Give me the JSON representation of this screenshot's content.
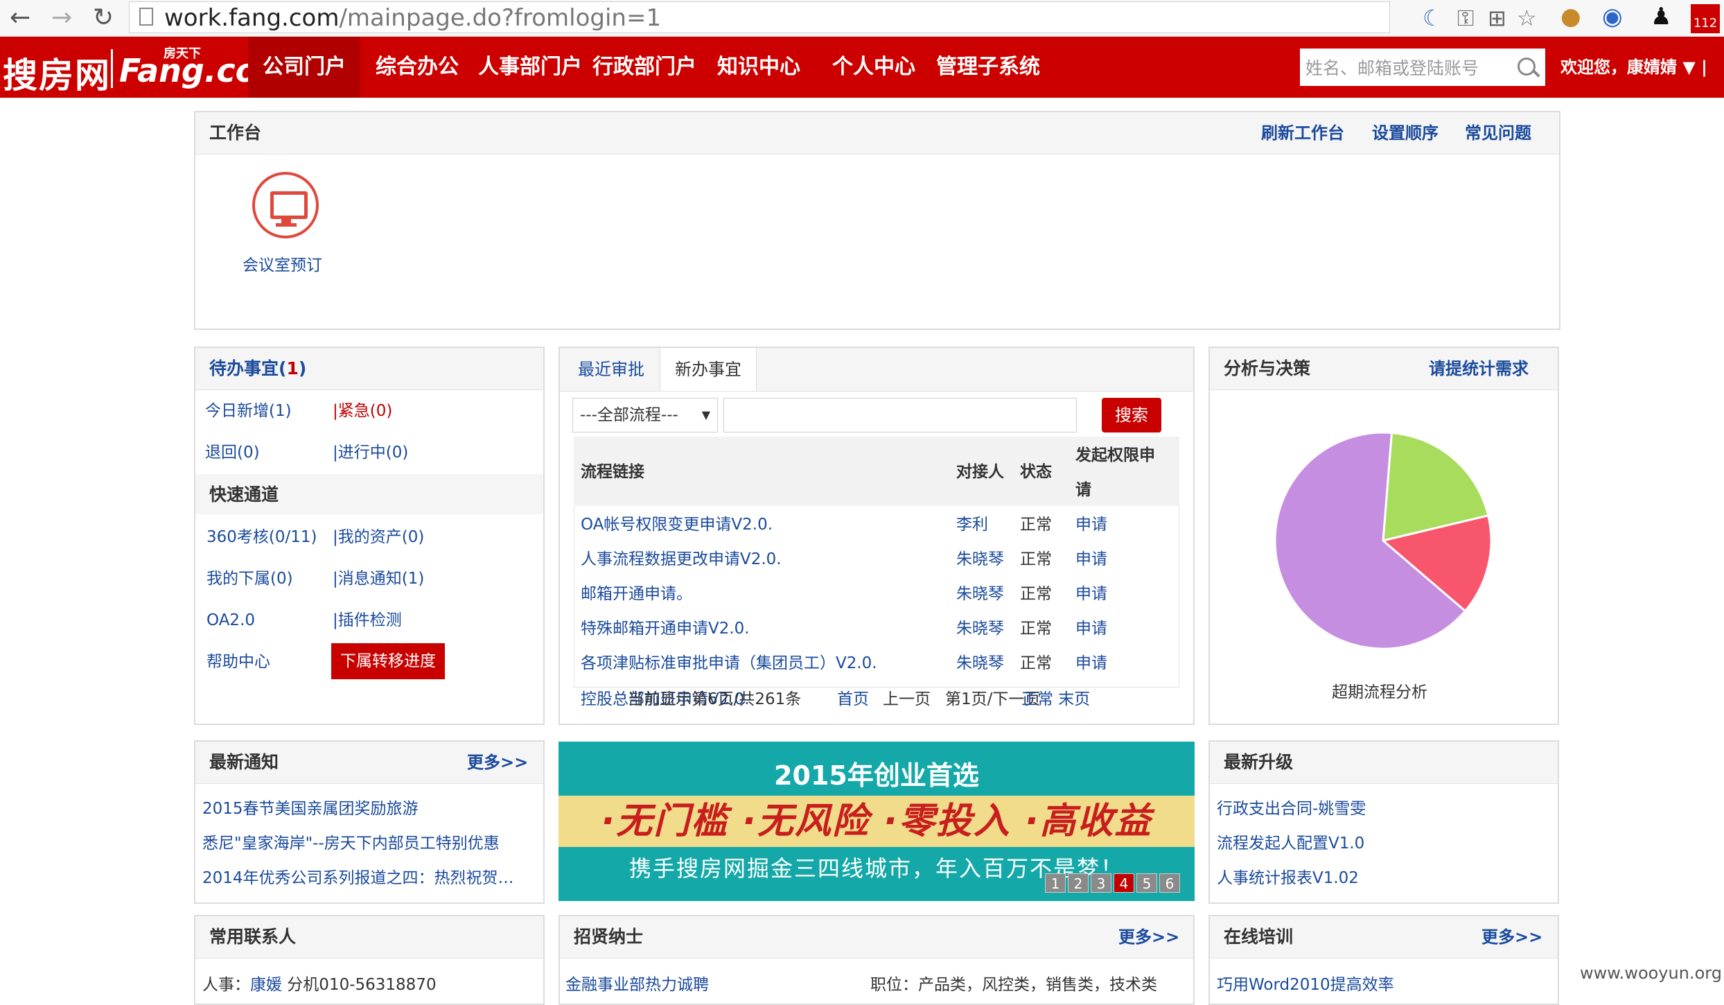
{
  "browser": {
    "url_host": "work.fang.com",
    "url_rest": "/mainpage.do?fromlogin=1",
    "badge": "112"
  },
  "header": {
    "logo_cn": "搜房网",
    "logo_en": "Fang.com",
    "logo_small": "房天下",
    "menu": [
      "公司门户",
      "综合办公",
      "人事部门户",
      "行政部门户",
      "知识中心",
      "个人中心",
      "管理子系统"
    ],
    "search_placeholder": "姓名、邮箱或登陆账号",
    "welcome": "欢迎您，康婧婧 ▼ |"
  },
  "workbench": {
    "title": "工作台",
    "links": [
      "刷新工作台",
      "设置顺序",
      "常见问题"
    ],
    "apps": [
      {
        "label": "会议室预订",
        "icon": "monitor-icon"
      }
    ]
  },
  "todo": {
    "title_prefix": "待办事宜(",
    "title_count": "1",
    "title_suffix": ")",
    "today_new": "今日新增(1)",
    "urgent": "|紧急(0)",
    "returned": "退回(0)",
    "in_progress": "|进行中(0)",
    "quick_title": "快速通道",
    "quick": {
      "r1a": "360考核(0/11)",
      "r1b": "|我的资产(0)",
      "r2a": "我的下属(0)",
      "r2b": "|消息通知(1)",
      "r3a": "OA2.0",
      "r3b": "|插件检测",
      "r4a": "帮助中心",
      "r4b": "下属转移进度"
    }
  },
  "process": {
    "tabs": [
      "最近审批",
      "新办事宜"
    ],
    "select_value": "---全部流程---",
    "search_button": "搜索",
    "headers": {
      "link": "流程链接",
      "contact": "对接人",
      "status": "状态",
      "perm_1": "发起权限申",
      "perm_2": "请"
    },
    "rows": [
      {
        "name": "OA帐号权限变更申请V2.0.",
        "contact": "李利",
        "status": "正常",
        "action": "申请"
      },
      {
        "name": "人事流程数据更改申请V2.0.",
        "contact": "朱晓琴",
        "status": "正常",
        "action": "申请"
      },
      {
        "name": "邮箱开通申请。",
        "contact": "朱晓琴",
        "status": "正常",
        "action": "申请"
      },
      {
        "name": "特殊邮箱开通申请V2.0.",
        "contact": "朱晓琴",
        "status": "正常",
        "action": "申请"
      },
      {
        "name": "各项津贴标准审批申请（集团员工）V2.0.",
        "contact": "朱晓琴",
        "status": "正常",
        "action": "申请"
      }
    ],
    "overflow_row": "控股总部加班申请V2.0.",
    "pagination": {
      "summary": "当前显示第6页/共261条",
      "first": "首页",
      "prev": "上一页",
      "next": "第1页/下一页",
      "last": "正常 末页"
    }
  },
  "analysis": {
    "title": "分析与决策",
    "link": "请提统计需求",
    "caption": "超期流程分析"
  },
  "chart_data": {
    "type": "pie",
    "title": "",
    "slices": [
      {
        "value": 0.2,
        "color": "#a8dc5c"
      },
      {
        "value": 0.15,
        "color": "#f8566c"
      },
      {
        "value": 0.65,
        "color": "#c68ee0"
      }
    ]
  },
  "notices": {
    "title": "最新通知",
    "more": "更多>>",
    "items": [
      "2015春节美国亲属团奖励旅游",
      "悉尼\"皇家海岸\"--房天下内部员工特别优惠",
      "2014年优秀公司系列报道之四：热烈祝贺…"
    ]
  },
  "banner": {
    "line1": "2015年创业首选",
    "line2": "·无门槛 ·无风险 ·零投入 ·高收益",
    "line3": "携手搜房网掘金三四线城市，年入百万不是梦！",
    "pages": [
      "1",
      "2",
      "3",
      "4",
      "5",
      "6"
    ],
    "active_page": "4"
  },
  "upgrades": {
    "title": "最新升级",
    "items": [
      "行政支出合同-姚雪雯",
      "流程发起人配置V1.0",
      "人事统计报表V1.02"
    ]
  },
  "contacts": {
    "title": "常用联系人",
    "label": "人事：",
    "name": "康媛",
    "phone": " 分机010-56318870"
  },
  "recruit": {
    "title": "招贤纳士",
    "more": "更多>>",
    "job": "金融事业部热力诚聘",
    "position": "职位：产品类，风控类，销售类，技术类"
  },
  "training": {
    "title": "在线培训",
    "more": "更多>>",
    "item": "巧用Word2010提高效率"
  },
  "watermark": "www.wooyun.org"
}
